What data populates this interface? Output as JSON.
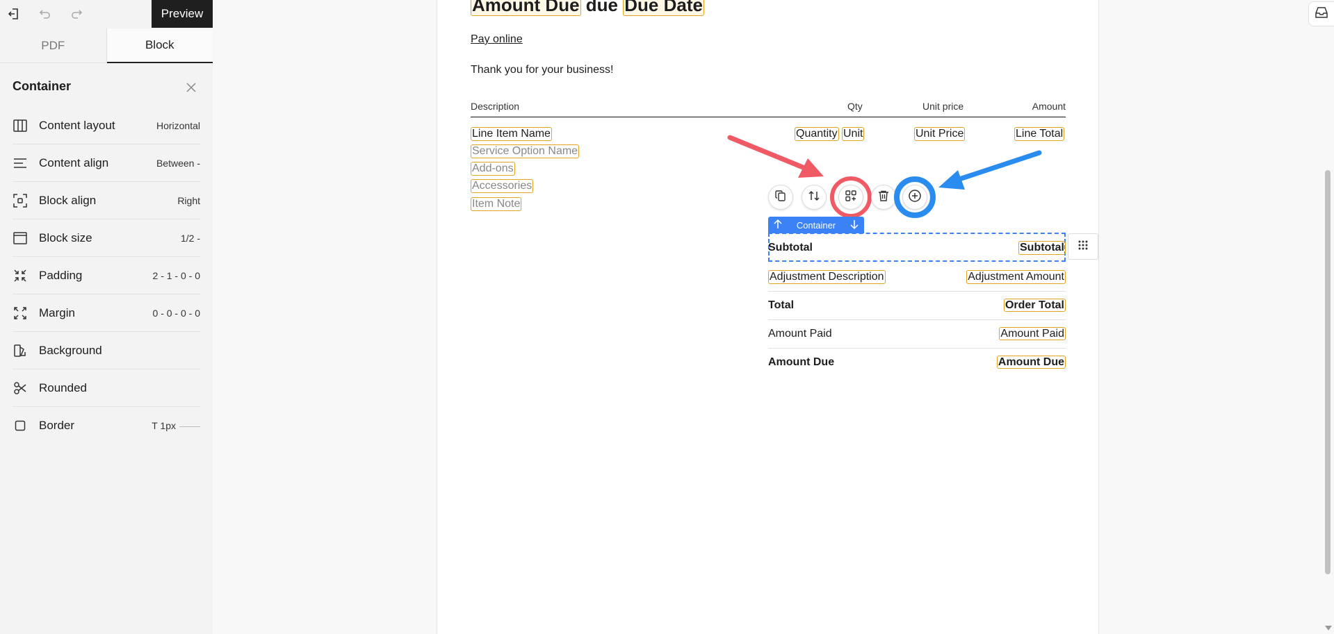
{
  "toolbar": {
    "preview_label": "Preview",
    "icons": [
      "exit-icon",
      "undo-icon",
      "redo-icon"
    ]
  },
  "tabs": [
    {
      "label": "PDF",
      "active": false
    },
    {
      "label": "Block",
      "active": true
    }
  ],
  "panel": {
    "title": "Container",
    "properties": [
      {
        "label": "Content layout",
        "value": "Horizontal",
        "icon": "columns-icon"
      },
      {
        "label": "Content align",
        "value": "Between -",
        "icon": "align-left-icon"
      },
      {
        "label": "Block align",
        "value": "Right",
        "icon": "focus-frame-icon"
      },
      {
        "label": "Block size",
        "value": "1/2 -",
        "icon": "window-icon"
      },
      {
        "label": "Padding",
        "value": "2 - 1 - 0 - 0",
        "icon": "shrink-icon"
      },
      {
        "label": "Margin",
        "value": "0 - 0 - 0 - 0",
        "icon": "expand-icon"
      },
      {
        "label": "Background",
        "value": "",
        "icon": "palette-icon"
      },
      {
        "label": "Rounded",
        "value": "",
        "icon": "scissors-icon"
      },
      {
        "label": "Border",
        "value": "T 1px",
        "icon": "square-icon"
      }
    ]
  },
  "document": {
    "heading": {
      "part1": "Amount Due",
      "mid": "due",
      "part2": "Due Date"
    },
    "pay_link": "Pay online",
    "thanks": "Thank you for your business!",
    "table_headers": {
      "description": "Description",
      "qty": "Qty",
      "unit_price": "Unit price",
      "amount": "Amount"
    },
    "line_item": {
      "name": "Line Item Name",
      "quantity": "Quantity",
      "unit": "Unit",
      "unit_price": "Unit Price",
      "line_total": "Line Total",
      "sub_items": [
        "Service Option Name",
        "Add-ons",
        "Accessories",
        "Item Note"
      ]
    },
    "container_label": "Container",
    "totals": [
      {
        "label": "Subtotal",
        "value": "Subtotal",
        "bold": true
      },
      {
        "label": "Adjustment Description",
        "value": "Adjustment Amount",
        "bold": false,
        "label_is_chip": true
      },
      {
        "label": "Total",
        "value": "Order Total",
        "bold": true
      },
      {
        "label": "Amount Paid",
        "value": "Amount Paid",
        "bold": false
      },
      {
        "label": "Amount Due",
        "value": "Amount Due",
        "bold": true
      }
    ]
  },
  "colors": {
    "chip_border": "#e0a41f",
    "selection_blue": "#3b82f6",
    "annotation_red": "#ef5a64",
    "annotation_blue": "#2b8cf0"
  }
}
